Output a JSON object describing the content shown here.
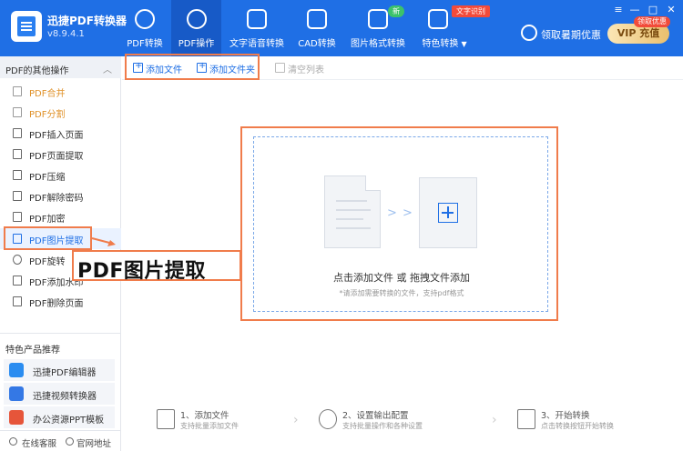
{
  "app": {
    "name": "迅捷PDF转换器",
    "version": "v8.9.4.1"
  },
  "nav": {
    "tabs": [
      {
        "label": "PDF转换",
        "icon": "convert-icon"
      },
      {
        "label": "PDF操作",
        "icon": "gear-icon",
        "active": true
      },
      {
        "label": "文字语音转换",
        "icon": "audio-wave-icon"
      },
      {
        "label": "CAD转换",
        "icon": "download-box-icon"
      },
      {
        "label": "图片格式转换",
        "icon": "image-icon",
        "badge": "新"
      },
      {
        "label": "特色转换",
        "icon": "star-box-icon",
        "badge": "文字识别",
        "dropdown": "▼"
      }
    ],
    "promo_text": "领取暑期优惠",
    "vip_label": "VIP 充值",
    "vip_badge": "领取优惠",
    "window_controls": [
      "≡",
      "—",
      "□",
      "✕"
    ]
  },
  "sidebar": {
    "title": "PDF的其他操作",
    "chevron": "︿",
    "items": [
      {
        "label": "PDF合并",
        "icon": "merge-icon"
      },
      {
        "label": "PDF分割",
        "icon": "split-icon"
      },
      {
        "label": "PDF插入页面",
        "icon": "insert-page-icon"
      },
      {
        "label": "PDF页面提取",
        "icon": "extract-page-icon"
      },
      {
        "label": "PDF压缩",
        "icon": "compress-icon"
      },
      {
        "label": "PDF解除密码",
        "icon": "unlock-icon"
      },
      {
        "label": "PDF加密",
        "icon": "shield-icon"
      },
      {
        "label": "PDF图片提取",
        "icon": "image-icon",
        "selected": true
      },
      {
        "label": "PDF旋转",
        "icon": "rotate-icon"
      },
      {
        "label": "PDF添加水印",
        "icon": "watermark-icon"
      },
      {
        "label": "PDF删除页面",
        "icon": "delete-page-icon"
      }
    ],
    "featured_title": "特色产品推荐",
    "featured": [
      {
        "label": "迅捷PDF编辑器",
        "icon": "pdf-editor-icon",
        "color": "#2a8cf0"
      },
      {
        "label": "迅捷视频转换器",
        "icon": "video-converter-icon",
        "color": "#3478e5"
      },
      {
        "label": "办公资源PPT模板",
        "icon": "ppt-template-icon",
        "color": "#e6553a"
      }
    ],
    "footer": {
      "support": "在线客服",
      "website": "官网地址"
    }
  },
  "toolbar": {
    "add_file": "添加文件",
    "add_folder": "添加文件夹",
    "clear_list": "清空列表"
  },
  "drop_zone": {
    "title": "点击添加文件 或 拖拽文件添加",
    "hint": "*请添加需要转换的文件，支持pdf格式",
    "arrows": "> > >"
  },
  "callout": {
    "text": "PDF图片提取"
  },
  "steps": [
    {
      "title": "1、添加文件",
      "subtitle": "支持批量添加文件",
      "icon": "add-file-icon"
    },
    {
      "title": "2、设置输出配置",
      "subtitle": "支持批量操作和各种设置",
      "icon": "settings-gear-icon"
    },
    {
      "title": "3、开始转换",
      "subtitle": "点击转换按钮开始转换",
      "icon": "start-convert-icon"
    }
  ],
  "step_separator": "›",
  "colors": {
    "primary": "#1f6fe5",
    "highlight": "#f07c4b",
    "accent_orange": "#e0922a"
  }
}
